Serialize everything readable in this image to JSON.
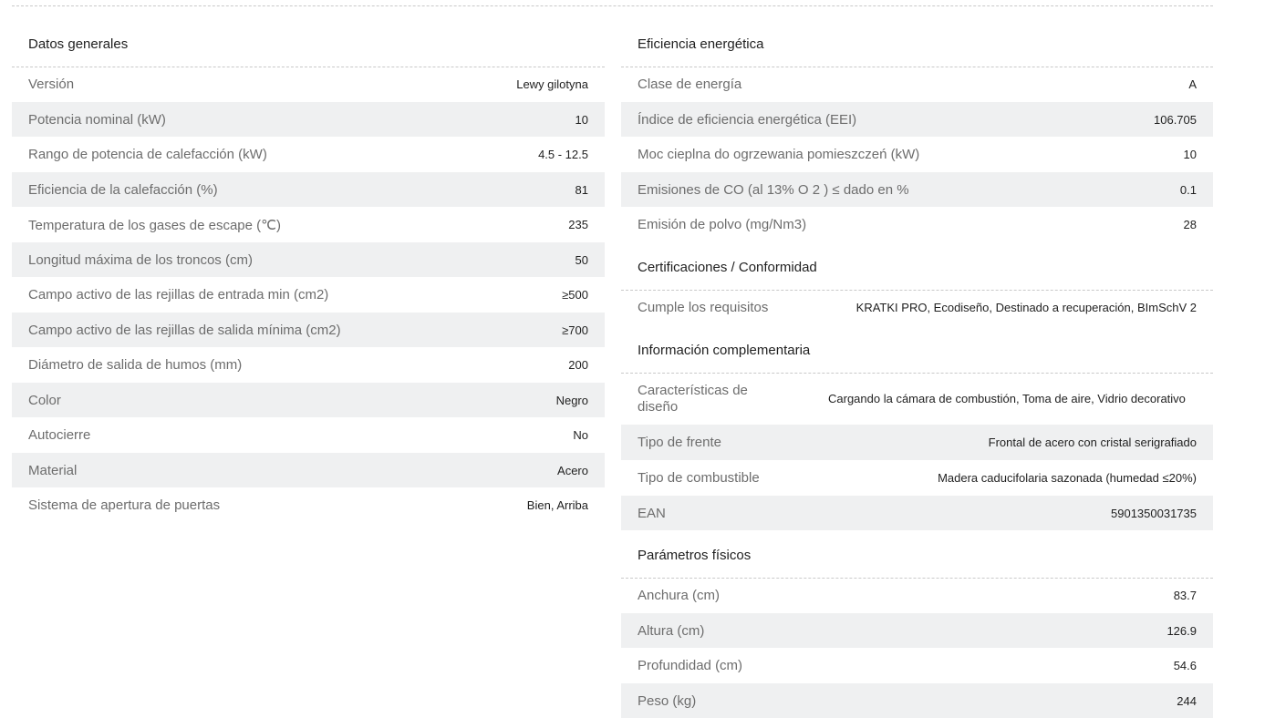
{
  "left": {
    "title": "Datos generales",
    "rows": [
      {
        "label": "Versión",
        "value": "Lewy gilotyna"
      },
      {
        "label": "Potencia nominal (kW)",
        "value": "10"
      },
      {
        "label": "Rango de potencia de calefacción (kW)",
        "value": "4.5 - 12.5"
      },
      {
        "label": "Eficiencia de la calefacción (%)",
        "value": "81"
      },
      {
        "label": "Temperatura de los gases de escape (℃)",
        "value": "235"
      },
      {
        "label": "Longitud máxima de los troncos (cm)",
        "value": "50"
      },
      {
        "label": "Campo activo de las rejillas de entrada min (cm2)",
        "value": "≥500"
      },
      {
        "label": "Campo activo de las rejillas de salida mínima (cm2)",
        "value": "≥700"
      },
      {
        "label": "Diámetro de salida de humos (mm)",
        "value": "200"
      },
      {
        "label": "Color",
        "value": "Negro"
      },
      {
        "label": "Autocierre",
        "value": "No"
      },
      {
        "label": "Material",
        "value": "Acero"
      },
      {
        "label": "Sistema de apertura de puertas",
        "value": "Bien, Arriba"
      }
    ]
  },
  "right": {
    "energy": {
      "title": "Eficiencia energética",
      "rows": [
        {
          "label": "Clase de energía",
          "value": "A"
        },
        {
          "label": "Índice de eficiencia energética (EEI)",
          "value": "106.705"
        },
        {
          "label": "Moc cieplna do ogrzewania pomieszczeń (kW)",
          "value": "10"
        },
        {
          "label": "Emisiones de CO (al 13% O 2 ) ≤ dado en %",
          "value": "0.1"
        },
        {
          "label": "Emisión de polvo (mg/Nm3)",
          "value": "28"
        }
      ]
    },
    "certs": {
      "title": "Certificaciones / Conformidad",
      "rows": [
        {
          "label": "Cumple los requisitos",
          "value": "KRATKI PRO, Ecodiseño, Destinado a recuperación, BImSchV 2"
        }
      ]
    },
    "extra": {
      "title": "Información complementaria",
      "rows": [
        {
          "label": "Características de diseño",
          "value": "Cargando la cámara de combustión, Toma de aire, Vidrio decorativo"
        },
        {
          "label": "Tipo de frente",
          "value": "Frontal de acero con cristal serigrafiado"
        },
        {
          "label": "Tipo de combustible",
          "value": "Madera caducifolaria sazonada (humedad ≤20%)"
        },
        {
          "label": "EAN",
          "value": "5901350031735"
        }
      ]
    },
    "physical": {
      "title": "Parámetros físicos",
      "rows": [
        {
          "label": "Anchura (cm)",
          "value": "83.7"
        },
        {
          "label": "Altura (cm)",
          "value": "126.9"
        },
        {
          "label": "Profundidad (cm)",
          "value": "54.6"
        },
        {
          "label": "Peso (kg)",
          "value": "244"
        }
      ]
    }
  }
}
